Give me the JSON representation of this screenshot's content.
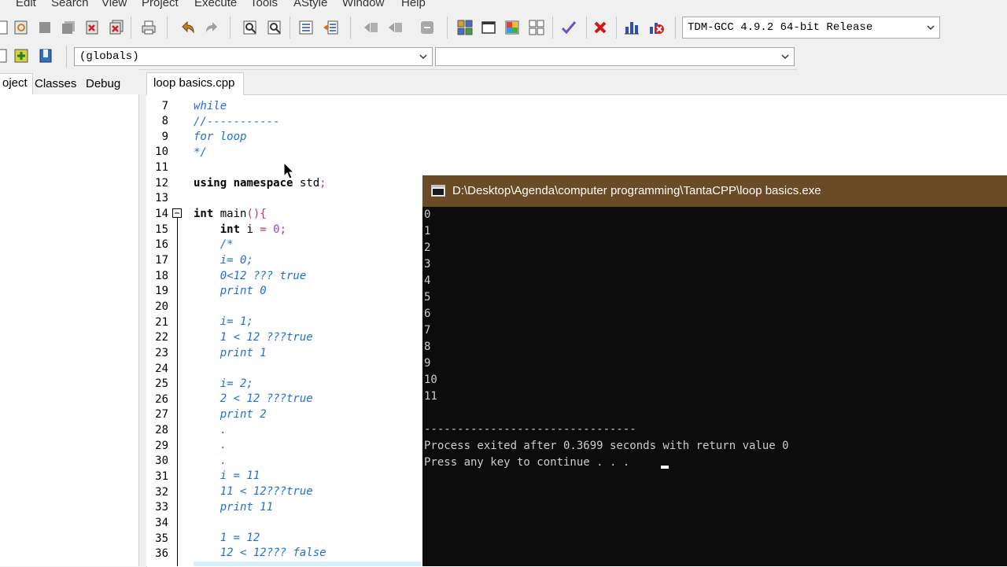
{
  "menu": [
    "Edit",
    "Search",
    "View",
    "Project",
    "Execute",
    "Tools",
    "AStyle",
    "Window",
    "Help"
  ],
  "toolbar": {
    "compiler_select": "TDM-GCC 4.9.2 64-bit Release",
    "scope_select": "(globals)",
    "function_select": ""
  },
  "left_panel": {
    "tabs": [
      "oject",
      "Classes",
      "Debug"
    ]
  },
  "editor": {
    "file_tab": "loop basics.cpp",
    "line_numbers": [
      "7",
      "8",
      "9",
      "10",
      "11",
      "12",
      "13",
      "14",
      "15",
      "16",
      "17",
      "18",
      "19",
      "20",
      "21",
      "22",
      "23",
      "24",
      "25",
      "26",
      "27",
      "28",
      "29",
      "30",
      "31",
      "32",
      "33",
      "34",
      "35",
      "36"
    ]
  },
  "console": {
    "title": "D:\\Desktop\\Agenda\\computer programming\\TantaCPP\\loop basics.exe",
    "output_lines": [
      "0",
      "1",
      "2",
      "3",
      "4",
      "5",
      "6",
      "7",
      "8",
      "9",
      "10",
      "11"
    ],
    "separator": "--------------------------------",
    "exit_message": "Process exited after 0.3699 seconds with return value 0",
    "prompt": "Press any key to continue . . . "
  },
  "colors": {
    "comment": "#1e6fd4",
    "console_bg": "#0c0c0c",
    "console_title": "#6b4a26"
  }
}
